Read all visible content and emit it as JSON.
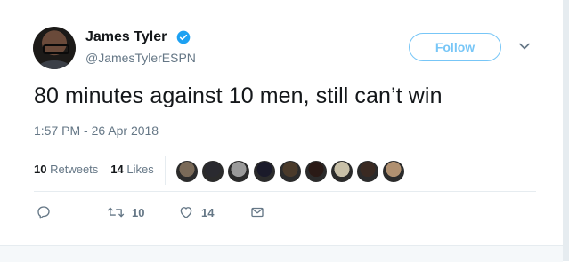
{
  "user": {
    "name": "James Tyler",
    "handle": "@JamesTylerESPN",
    "verified": true
  },
  "follow_label": "Follow",
  "tweet": {
    "text": "80 minutes against 10 men, still can’t win",
    "timestamp": "1:57 PM - 26 Apr 2018"
  },
  "stats": {
    "retweets_count": "10",
    "retweets_label": "Retweets",
    "likes_count": "14",
    "likes_label": "Likes"
  },
  "likers": [
    {
      "icon": "liker-avatar-1",
      "color": "#7a6a58"
    },
    {
      "icon": "liker-avatar-2",
      "color": "#2a2a30"
    },
    {
      "icon": "liker-avatar-3",
      "color": "#9a9a9a"
    },
    {
      "icon": "liker-avatar-4",
      "color": "#1a1a2a"
    },
    {
      "icon": "liker-avatar-5",
      "color": "#4a3a2a"
    },
    {
      "icon": "liker-avatar-6",
      "color": "#2a1a16"
    },
    {
      "icon": "liker-avatar-7",
      "color": "#c8c0a8"
    },
    {
      "icon": "liker-avatar-8",
      "color": "#3a2a22"
    },
    {
      "icon": "liker-avatar-9",
      "color": "#b09070"
    }
  ],
  "actions": {
    "retweet_count": "10",
    "like_count": "14"
  },
  "colors": {
    "accent": "#1da1f2",
    "muted": "#657786",
    "text": "#14171a",
    "border": "#e6ecf0"
  }
}
